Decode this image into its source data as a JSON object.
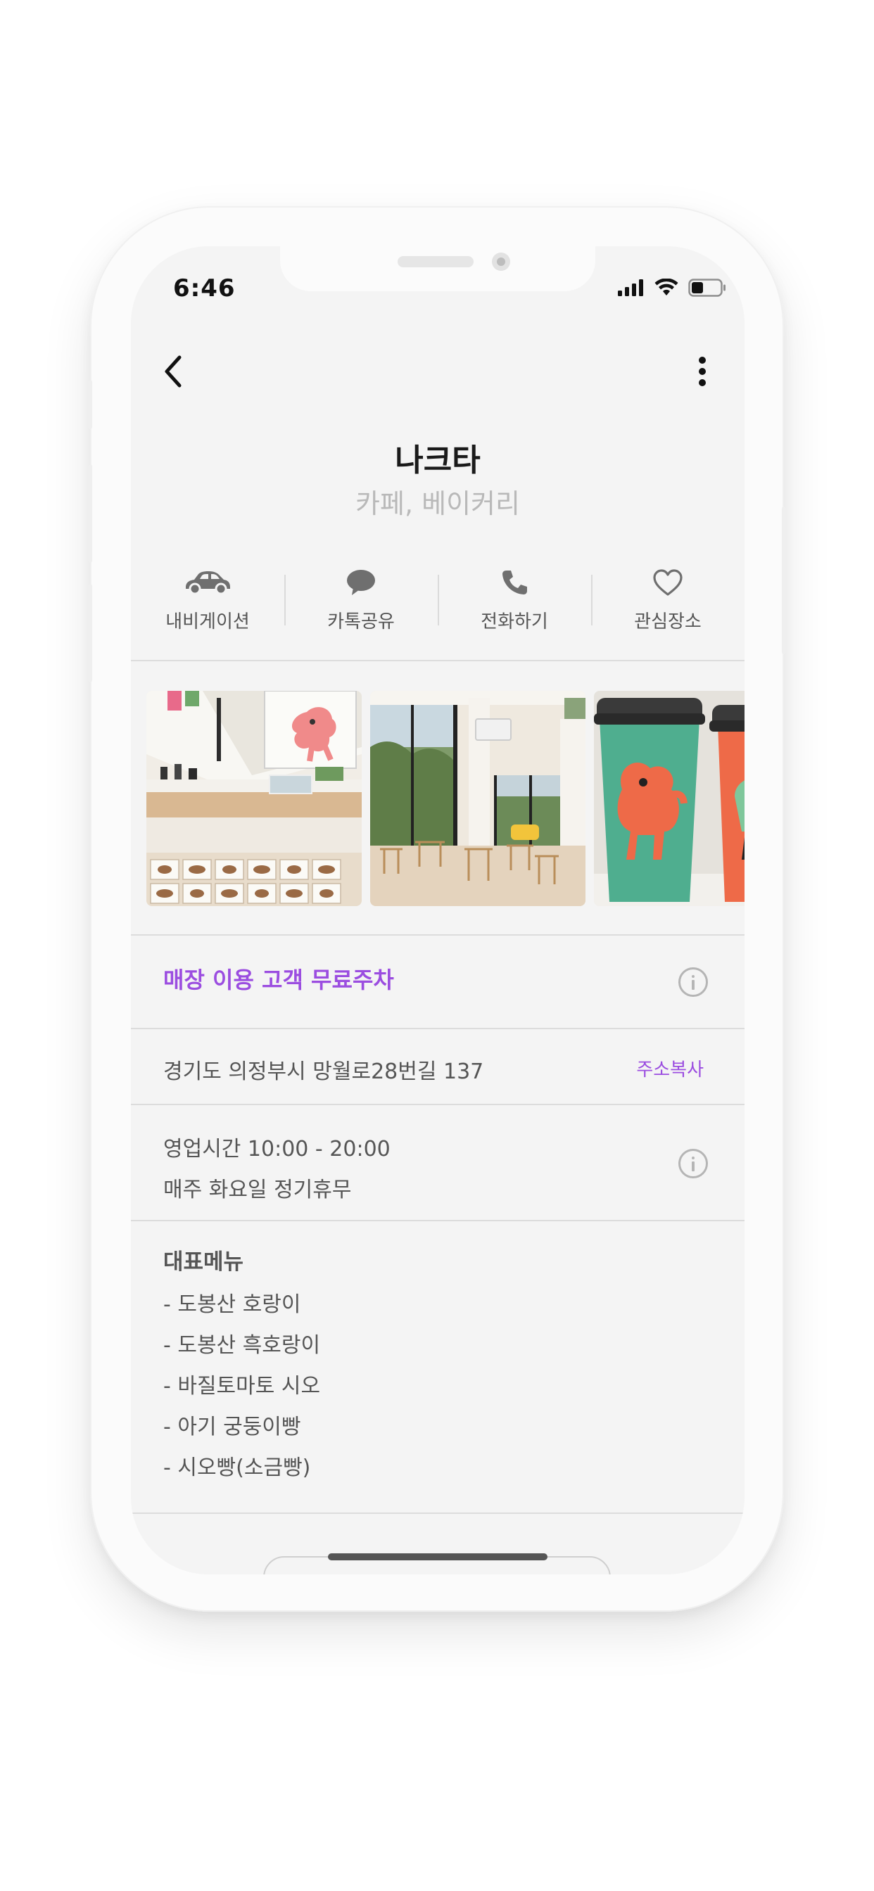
{
  "status_bar": {
    "time": "6:46",
    "icons": [
      "cellular-signal-icon",
      "wifi-icon",
      "battery-icon"
    ]
  },
  "header": {
    "back_icon": "chevron-left-icon",
    "more_icon": "vertical-ellipsis-icon"
  },
  "place": {
    "name": "나크타",
    "category": "카페, 베이커리"
  },
  "actions": [
    {
      "icon": "car-icon",
      "label": "내비게이션"
    },
    {
      "icon": "chat-bubble-icon",
      "label": "카톡공유"
    },
    {
      "icon": "phone-icon",
      "label": "전화하기"
    },
    {
      "icon": "heart-icon",
      "label": "관심장소"
    }
  ],
  "photos": [
    {
      "name": "photo-cafe-counter"
    },
    {
      "name": "photo-cafe-interior"
    },
    {
      "name": "photo-coffee-cups"
    }
  ],
  "notice": {
    "text": "매장 이용 고객 무료주차",
    "color": "#9b4de0"
  },
  "address": {
    "text": "경기도 의정부시 망월로28번길 137",
    "copy_label": "주소복사"
  },
  "hours": {
    "line1": "영업시간 10:00 - 20:00",
    "line2": "매주 화요일 정기휴무"
  },
  "menu": {
    "title": "대표메뉴",
    "items": [
      "- 도봉산 호랑이",
      "- 도봉산 흑호랑이",
      "- 바질토마토 시오",
      "- 아기 궁둥이빵",
      "- 시오빵(소금빵)"
    ]
  },
  "colors": {
    "accent": "#9b4de0",
    "background": "#f4f4f4"
  }
}
